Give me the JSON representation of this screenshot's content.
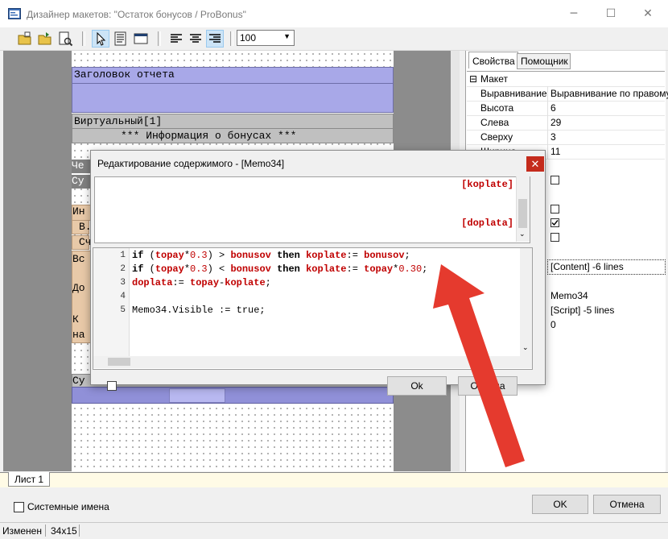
{
  "window": {
    "title": "Дизайнер макетов: \"Остаток бонусов / ProBonus\"",
    "controls": {
      "minimize": "─",
      "maximize": "☐",
      "close": "✕"
    }
  },
  "toolbar": {
    "zoom_value": "100"
  },
  "design": {
    "bands": {
      "report_header": "Заголовок отчета",
      "virtual": "Виртуальный[1]",
      "info": "*** Информация о бонусах ***"
    },
    "partial_labels": [
      "Че",
      "Су",
      "Ин",
      "В.",
      "Сч",
      "Вс",
      "До",
      "К",
      "на",
      "Су"
    ]
  },
  "properties_panel": {
    "tabs": [
      "Свойства",
      "Помощник"
    ],
    "group": "Макет",
    "rows": [
      {
        "name": "Выравнивание",
        "value": "Выравнивание по правому"
      },
      {
        "name": "Высота",
        "value": "6"
      },
      {
        "name": "Слева",
        "value": "29"
      },
      {
        "name": "Сверху",
        "value": "3"
      },
      {
        "name": "Ширина",
        "value": "11"
      }
    ],
    "lower_values": {
      "content": "[Content] -6 lines",
      "name": "Memo34",
      "script": "[Script] -5 lines",
      "zero": "0"
    }
  },
  "sheet_tab": "Лист 1",
  "bottom": {
    "system_names_label": "Системные имена",
    "ok_label": "OK",
    "cancel_label": "Отмена"
  },
  "status": {
    "state": "Изменен",
    "size": "34x15"
  },
  "modal": {
    "title": "Редактирование содержимого - [Memo34]",
    "close": "✕",
    "memo_lines": [
      "[koplate]",
      "[doplata]"
    ],
    "code": {
      "line_numbers": [
        "1",
        "2",
        "3",
        "4",
        "5"
      ],
      "line5": "Memo34.Visible := true;"
    },
    "buttons": {
      "ok": "Ok",
      "cancel": "Отмена"
    }
  },
  "colors": {
    "band_blue": "#a8a8e8",
    "band_gray": "#c0c0c0",
    "band_peach": "#e8c9a8",
    "code_red": "#c00000",
    "arrow_red": "#e53a2e"
  }
}
